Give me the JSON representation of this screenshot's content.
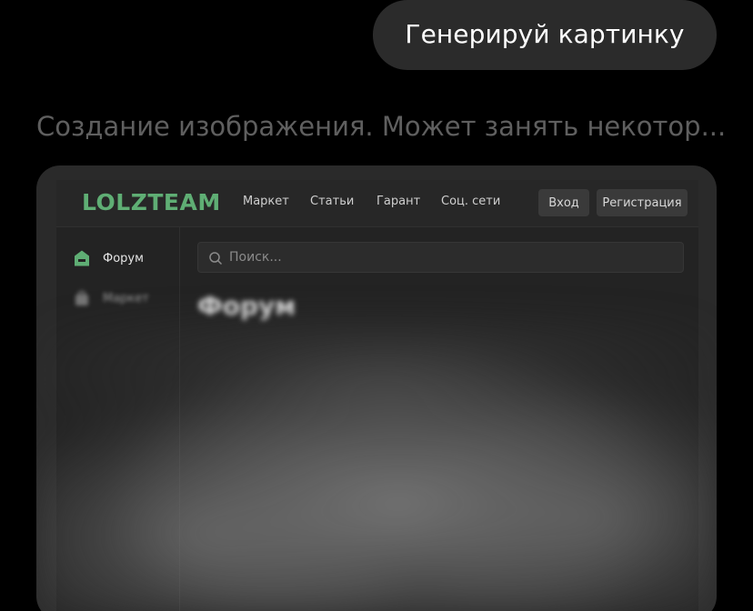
{
  "chat": {
    "user_message": "Генерируй картинку",
    "status": "Создание изображения. Может занять некотор..."
  },
  "mock_site": {
    "logo": "LOLZTEAM",
    "nav": [
      "Маркет",
      "Статьи",
      "Гарант",
      "Соц. сети"
    ],
    "login_label": "Вход",
    "register_label": "Регистрация",
    "sidebar": [
      {
        "label": "Форум",
        "icon": "home-icon"
      },
      {
        "label": "Маркет",
        "icon": "market-icon"
      }
    ],
    "search_placeholder": "Поиск...",
    "heading": "Форум"
  },
  "colors": {
    "page_bg": "#000000",
    "bubble_bg": "#2b2b2b",
    "status_text": "#5f5f5f",
    "logo_accent": "#5fae74"
  }
}
